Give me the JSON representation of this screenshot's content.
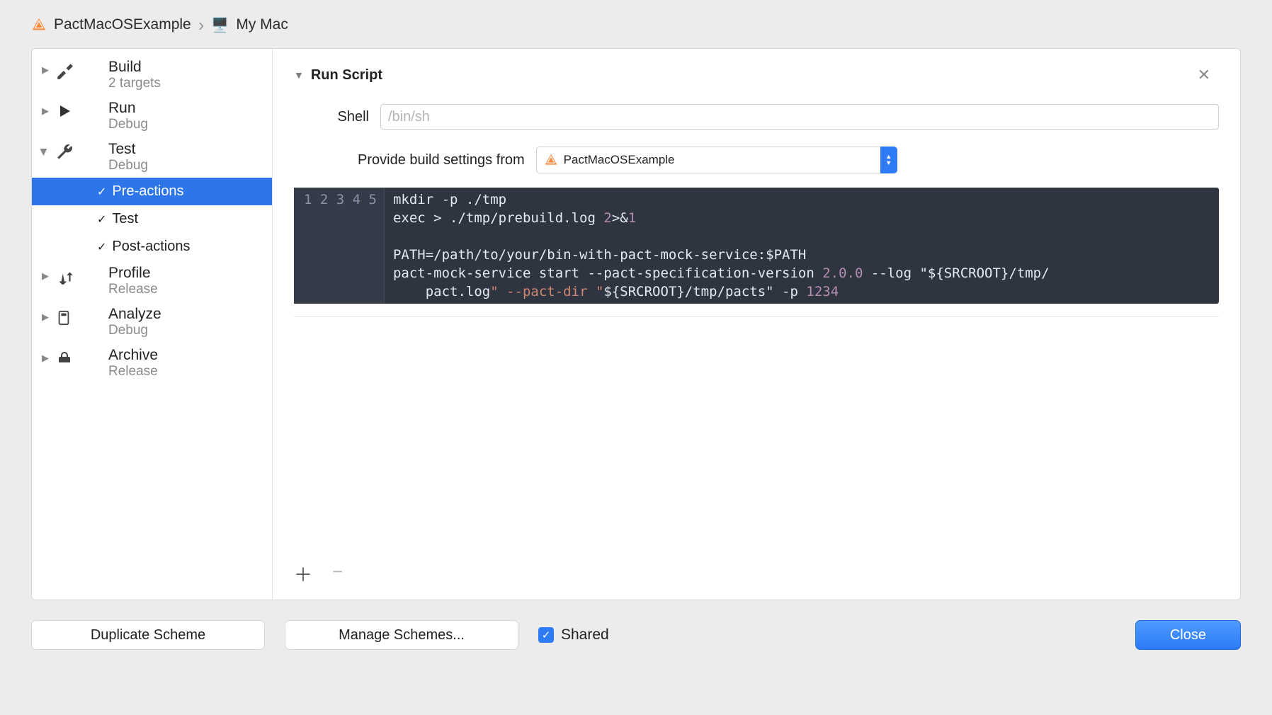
{
  "breadcrumb": {
    "scheme": "PactMacOSExample",
    "destination": "My Mac"
  },
  "sidebar": {
    "items": [
      {
        "title": "Build",
        "sub": "2 targets",
        "icon": "hammer",
        "expanded": false
      },
      {
        "title": "Run",
        "sub": "Debug",
        "icon": "play",
        "expanded": false
      },
      {
        "title": "Test",
        "sub": "Debug",
        "icon": "wrench",
        "expanded": true
      },
      {
        "title": "Profile",
        "sub": "Release",
        "icon": "gauge",
        "expanded": false
      },
      {
        "title": "Analyze",
        "sub": "Debug",
        "icon": "doc",
        "expanded": false
      },
      {
        "title": "Archive",
        "sub": "Release",
        "icon": "archive",
        "expanded": false
      }
    ],
    "test_children": [
      {
        "label": "Pre-actions",
        "selected": true
      },
      {
        "label": "Test",
        "selected": false
      },
      {
        "label": "Post-actions",
        "selected": false
      }
    ]
  },
  "content": {
    "section_title": "Run Script",
    "shell_label": "Shell",
    "shell_placeholder": "/bin/sh",
    "shell_value": "",
    "provide_label": "Provide build settings from",
    "provide_value": "PactMacOSExample",
    "script_lines": [
      "mkdir -p ./tmp",
      "exec > ./tmp/prebuild.log 2>&1",
      "",
      "PATH=/path/to/your/bin-with-pact-mock-service:$PATH",
      "pact-mock-service start --pact-specification-version 2.0.0 --log \"${SRCROOT}/tmp/pact.log\" --pact-dir \"${SRCROOT}/tmp/pacts\" -p 1234"
    ]
  },
  "footer": {
    "duplicate": "Duplicate Scheme",
    "manage": "Manage Schemes...",
    "shared_label": "Shared",
    "shared_checked": true,
    "close": "Close"
  }
}
